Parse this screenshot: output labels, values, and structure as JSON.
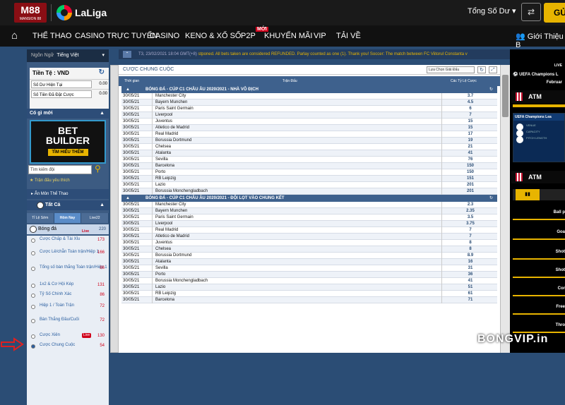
{
  "header": {
    "brand": "M88",
    "brand_sub": "MANSION 88",
    "laliga": "LaLiga",
    "balance_label": "Tổng Số Dư",
    "deposit_btn": "GỬI"
  },
  "nav": {
    "items": [
      "THỂ THAO",
      "CASINO TRỰC TUYẾN",
      "CASINO",
      "KENO & XỔ SỐ",
      "P2P",
      "KHUYẾN MÃI",
      "VIP",
      "TẢI VỀ"
    ],
    "badge_new": "MỚI",
    "login": "Giới Thiệu B"
  },
  "sidebar": {
    "language_label": "Ngôn Ngữ",
    "language_value": "Tiếng Việt",
    "currency": "Tiền Tệ : VND",
    "balance_label": "Số Dư Hiện Tại",
    "balance_value": "0.00",
    "bet_label": "Số Tiền Đã Đặt Cược",
    "bet_value": "0.00",
    "whats_new": "Có gì mới",
    "banner_line1": "BET",
    "banner_line2": "BUILDER",
    "banner_btn": "TÌM HIỂU THÊM",
    "search_placeholder": "Tìm kiếm đội",
    "favorites": "Trận đấu yêu thích",
    "hide_sports": "Ẩn Môn Thể Thao",
    "all_label": "Tất Cả",
    "tabs": [
      "Tỉ Lệ Sớm",
      "Hôm Nay",
      "Live22"
    ],
    "sport": "Bóng đá",
    "sport_live": "Live",
    "sport_count": "220",
    "bet_types": [
      {
        "label": "Cược Chấp & Tài Xỉu",
        "count": "173"
      },
      {
        "label": "Cược Lẻ/chẵn Toàn trận/Hiệp 1",
        "count": "166"
      },
      {
        "label": "Tổng số bàn thắng Toàn trận/Hiệp 1",
        "count": "86"
      },
      {
        "label": "1x2 & Cơ Hội Kép",
        "count": "131"
      },
      {
        "label": "Tỷ Số Chính Xác",
        "count": "86"
      },
      {
        "label": "Hiệp 1 / Toàn Trận",
        "count": "72"
      },
      {
        "label": "Bàn Thắng Đầu/Cuối",
        "count": "72"
      },
      {
        "label": "Cược Xiên",
        "count": "130"
      },
      {
        "label": "Cược Chung Cuộc",
        "count": "54"
      }
    ],
    "live_badge": "Live"
  },
  "ticker": {
    "date": "T3, 23/02/2021 18:04 GMT(+8)",
    "text": "stponed. All bets taken are considered REFUNDED. Parlay counted as one (1). Thank you!   Soccer: The match between FC Viitorul Constanta v"
  },
  "main": {
    "title": "CƯỢC CHUNG CUỘC",
    "select_label": "Lựa Chọn Giải Đấu",
    "columns": [
      "Thời gian",
      "Trận Đấu",
      "Các Tỷ Lệ Cược"
    ],
    "groups": [
      {
        "title": "BÓNG ĐÁ - CÚP C1 CHÂU ÂU 2020/2021 - NHÀ VÔ ĐỊCH",
        "rows": [
          [
            "30/05/21",
            "Manchester City",
            "3.7"
          ],
          [
            "30/05/21",
            "Bayern Munchen",
            "4.5"
          ],
          [
            "30/05/21",
            "Paris Saint Germain",
            "6"
          ],
          [
            "30/05/21",
            "Liverpool",
            "7"
          ],
          [
            "30/05/21",
            "Juventus",
            "15"
          ],
          [
            "30/05/21",
            "Atletico de Madrid",
            "15"
          ],
          [
            "30/05/21",
            "Real Madrid",
            "17"
          ],
          [
            "30/05/21",
            "Borussia Dortmund",
            "19"
          ],
          [
            "30/05/21",
            "Chelsea",
            "21"
          ],
          [
            "30/05/21",
            "Atalanta",
            "41"
          ],
          [
            "30/05/21",
            "Sevilla",
            "76"
          ],
          [
            "30/05/21",
            "Barcelona",
            "150"
          ],
          [
            "30/05/21",
            "Porto",
            "150"
          ],
          [
            "30/05/21",
            "RB Leipzig",
            "151"
          ],
          [
            "30/05/21",
            "Lazio",
            "201"
          ],
          [
            "30/05/21",
            "Borussia Monchengladbach",
            "201"
          ]
        ]
      },
      {
        "title": "BÓNG ĐÁ - CÚP C1 CHÂU ÂU 2020/2021 - ĐỘI LỌT VÀO CHUNG KẾT",
        "rows": [
          [
            "30/05/21",
            "Manchester City",
            "2.3"
          ],
          [
            "30/05/21",
            "Bayern Munchen",
            "2.35"
          ],
          [
            "30/05/21",
            "Paris Saint Germain",
            "3.5"
          ],
          [
            "30/05/21",
            "Liverpool",
            "3.75"
          ],
          [
            "30/05/21",
            "Real Madrid",
            "7"
          ],
          [
            "30/05/21",
            "Atletico de Madrid",
            "7"
          ],
          [
            "30/05/21",
            "Juventus",
            "8"
          ],
          [
            "30/05/21",
            "Chelsea",
            "8"
          ],
          [
            "30/05/21",
            "Borussia Dortmund",
            "8.9"
          ],
          [
            "30/05/21",
            "Atalanta",
            "16"
          ],
          [
            "30/05/21",
            "Sevilla",
            "31"
          ],
          [
            "30/05/21",
            "Porto",
            "36"
          ],
          [
            "30/05/21",
            "Borussia Monchengladbach",
            "41"
          ],
          [
            "30/05/21",
            "Lazio",
            "51"
          ],
          [
            "30/05/21",
            "RB Leipzig",
            "61"
          ],
          [
            "30/05/21",
            "Barcelona",
            "71"
          ]
        ]
      }
    ]
  },
  "right_panel": {
    "live": "LIVE",
    "competition": "UEFA Champions L",
    "date": "Februar",
    "team": "ATM",
    "card_title": "UEFA Champions Lea",
    "venue_label": "VENUE",
    "capacity_label": "CAPACITY",
    "pitch_label": "PITCH LENGTH",
    "labels": [
      "Ball p",
      "Goa",
      "Shot",
      "Shot",
      "Cor",
      "Free",
      "Thro"
    ]
  },
  "watermark": "BONGVIP.in"
}
